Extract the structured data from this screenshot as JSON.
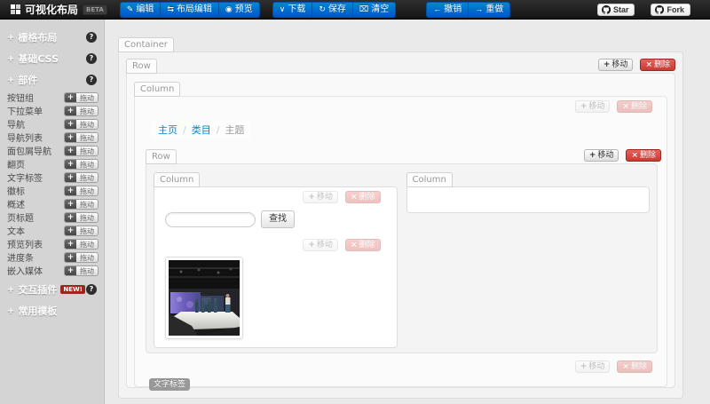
{
  "navbar": {
    "brand": "可视化布局",
    "beta": "BETA",
    "buttons": {
      "edit": "编辑",
      "layout_edit": "布局编辑",
      "preview": "预览",
      "download": "下载",
      "save": "保存",
      "clear": "清空",
      "undo": "撤销",
      "redo": "重做"
    },
    "github": {
      "star": "Star",
      "fork": "Fork"
    }
  },
  "icons": {
    "edit": "✎",
    "layout_edit": "⇆",
    "preview": "◉",
    "download": "∨",
    "save": "↻",
    "clear": "⌧",
    "undo": "←",
    "redo": "→",
    "move": "+",
    "delete": "×",
    "drag": "+",
    "plus": "+",
    "qmark": "?"
  },
  "sidebar": {
    "sections": [
      {
        "label": "栅格布局",
        "badge": "?"
      },
      {
        "label": "基础CSS",
        "badge": "?"
      },
      {
        "label": "部件",
        "badge": "?",
        "items": [
          "按钮组",
          "下拉菜单",
          "导航",
          "导航列表",
          "面包屑导航",
          "翻页",
          "文字标签",
          "徽标",
          "概述",
          "页标题",
          "文本",
          "预览列表",
          "进度条",
          "嵌入媒体"
        ]
      },
      {
        "label": "交互插件",
        "badge": "?",
        "new_badge": "NEW!"
      },
      {
        "label": "常用模板"
      }
    ],
    "drag_label": "拖动"
  },
  "canvas": {
    "container_tab": "Container",
    "row_tab": "Row",
    "column_tab": "Column",
    "move_label": "移动",
    "delete_label": "删除",
    "breadcrumb": {
      "items": [
        "主页",
        "类目",
        "主题"
      ],
      "divider": "/"
    },
    "search_button": "查找",
    "search_value": "",
    "text_label_chip": "文字标签"
  },
  "colors": {
    "primary_blue": "#0088cc",
    "danger_red": "#bd362f",
    "new_badge_red": "#9d261d",
    "label_gray": "#999999",
    "navbar_black": "#1a1a1a",
    "sidebar_gray": "#d4d4d4"
  }
}
